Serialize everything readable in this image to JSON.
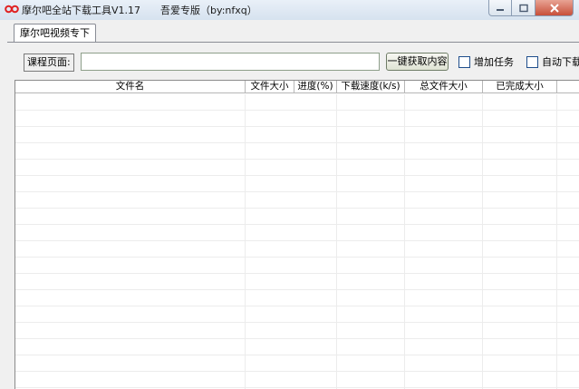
{
  "window": {
    "title": "摩尔吧全站下载工具V1.17",
    "subtitle": "吾爱专版（by:nfxq）"
  },
  "tabs": [
    {
      "label": "摩尔吧视频专下"
    }
  ],
  "form": {
    "course_label": "课程页面:",
    "course_value": "",
    "fetch_button": "一键获取内容",
    "add_task_label": "增加任务",
    "add_task_checked": false,
    "auto_download_label": "自动下载",
    "auto_download_checked": false
  },
  "table": {
    "columns": [
      "文件名",
      "文件大小",
      "进度(%)",
      "下载速度(k/s)",
      "总文件大小",
      "已完成大小"
    ],
    "rows": []
  },
  "colors": {
    "titlebar": "#dfe8f1",
    "close_button": "#c8503a",
    "app_icon": "#e02020"
  },
  "icons": [
    "app-icon",
    "minimize-icon",
    "maximize-icon",
    "close-icon"
  ]
}
